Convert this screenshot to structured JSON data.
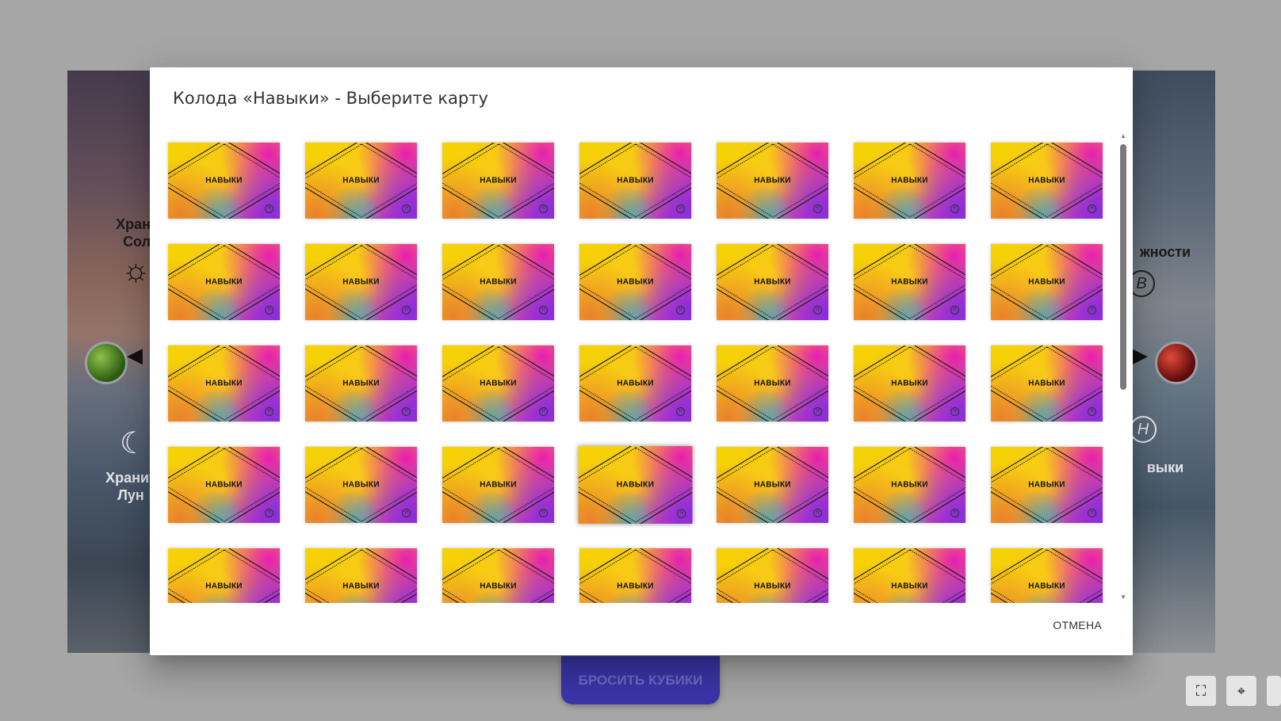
{
  "board": {
    "left_label_top": "Хранит\nСолн",
    "left_label_bottom": "Хранит\nЛун",
    "right_label_top": "жности",
    "right_label_bottom": "выки",
    "right_top_letter": "В",
    "right_bottom_letter": "Н"
  },
  "roll_button_label": "БРОСИТЬ КУБИКИ",
  "corner_controls": {
    "fullscreen_glyph": "⛶",
    "locate_glyph": "⌖"
  },
  "modal": {
    "title": "Колода «Навыки» - Выберите карту",
    "cancel_label": "ОТМЕНА",
    "scroll_up_glyph": "▲",
    "scroll_down_glyph": "▼"
  },
  "cards": {
    "label": "НАВЫКИ",
    "mark": "Н",
    "columns": 7,
    "visible_rows": 5,
    "count": 35,
    "highlighted_index": 24
  },
  "colors": {
    "modal_bg": "#ffffff",
    "roll_button": "#3b35a8",
    "backdrop": "#a6a6a6"
  }
}
